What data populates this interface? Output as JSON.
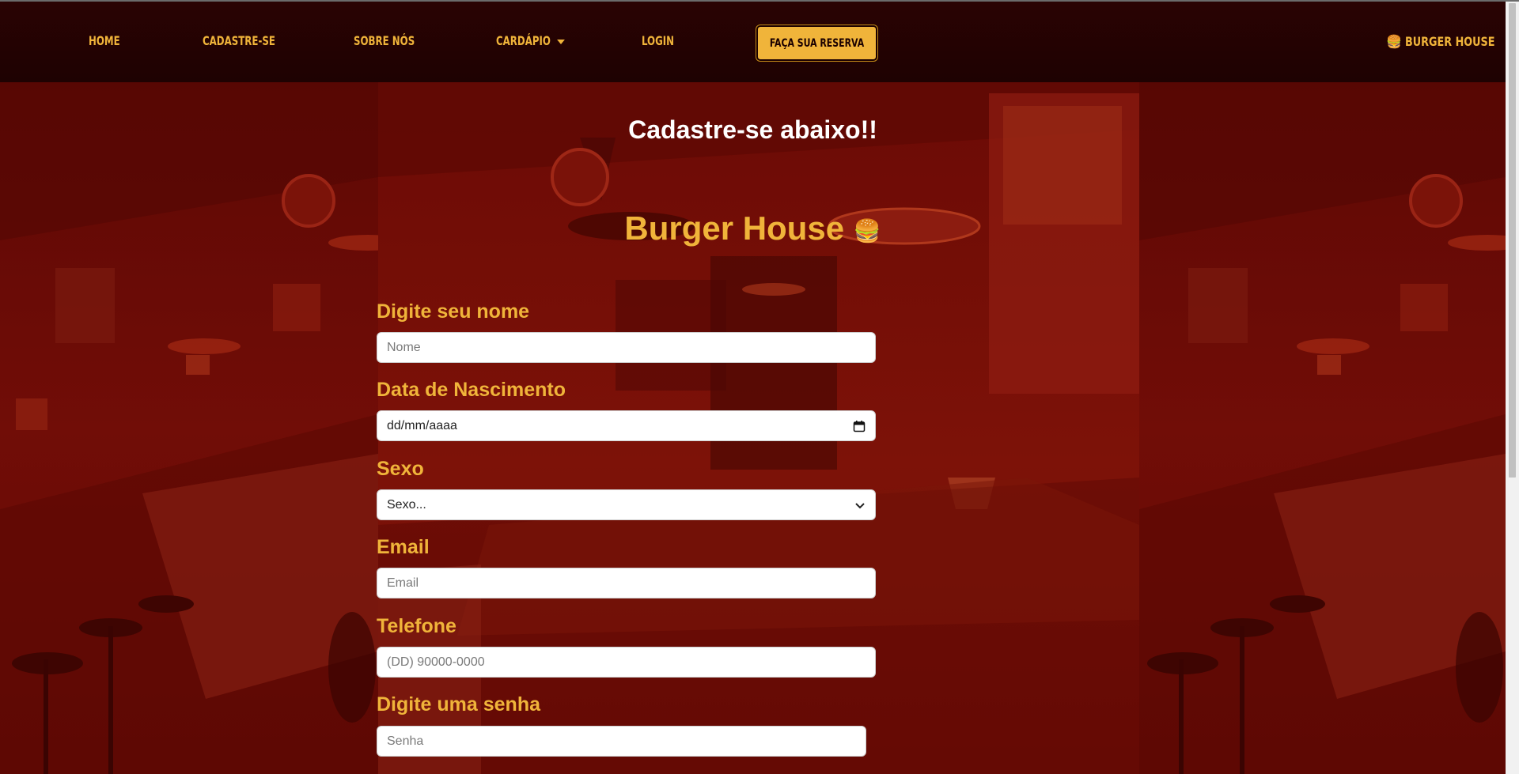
{
  "nav": {
    "links": [
      {
        "label": "Home"
      },
      {
        "label": "Cadastre-se"
      },
      {
        "label": "Sobre Nós"
      },
      {
        "label": "Cardápio"
      },
      {
        "label": "Login"
      }
    ],
    "reserve_button": "Faça sua reserva",
    "brand": "Burger House",
    "brand_icon": "burger-icon"
  },
  "page": {
    "heading": "Cadastre-se abaixo!!",
    "form_title": "Burger House",
    "form_title_icon": "burger-icon"
  },
  "form": {
    "name_label": "Digite seu nome",
    "name_placeholder": "Nome",
    "birth_label": "Data de Nascimento",
    "birth_placeholder": "dd/mm/aaaa",
    "sex_label": "Sexo",
    "sex_selected": "Sexo...",
    "email_label": "Email",
    "email_placeholder": "Email",
    "phone_label": "Telefone",
    "phone_placeholder": "(DD) 90000-0000",
    "password_label": "Digite uma senha",
    "password_placeholder": "Senha"
  },
  "colors": {
    "accent": "#f0b43a",
    "navbar": "#220202",
    "background": "#6a0a05"
  }
}
